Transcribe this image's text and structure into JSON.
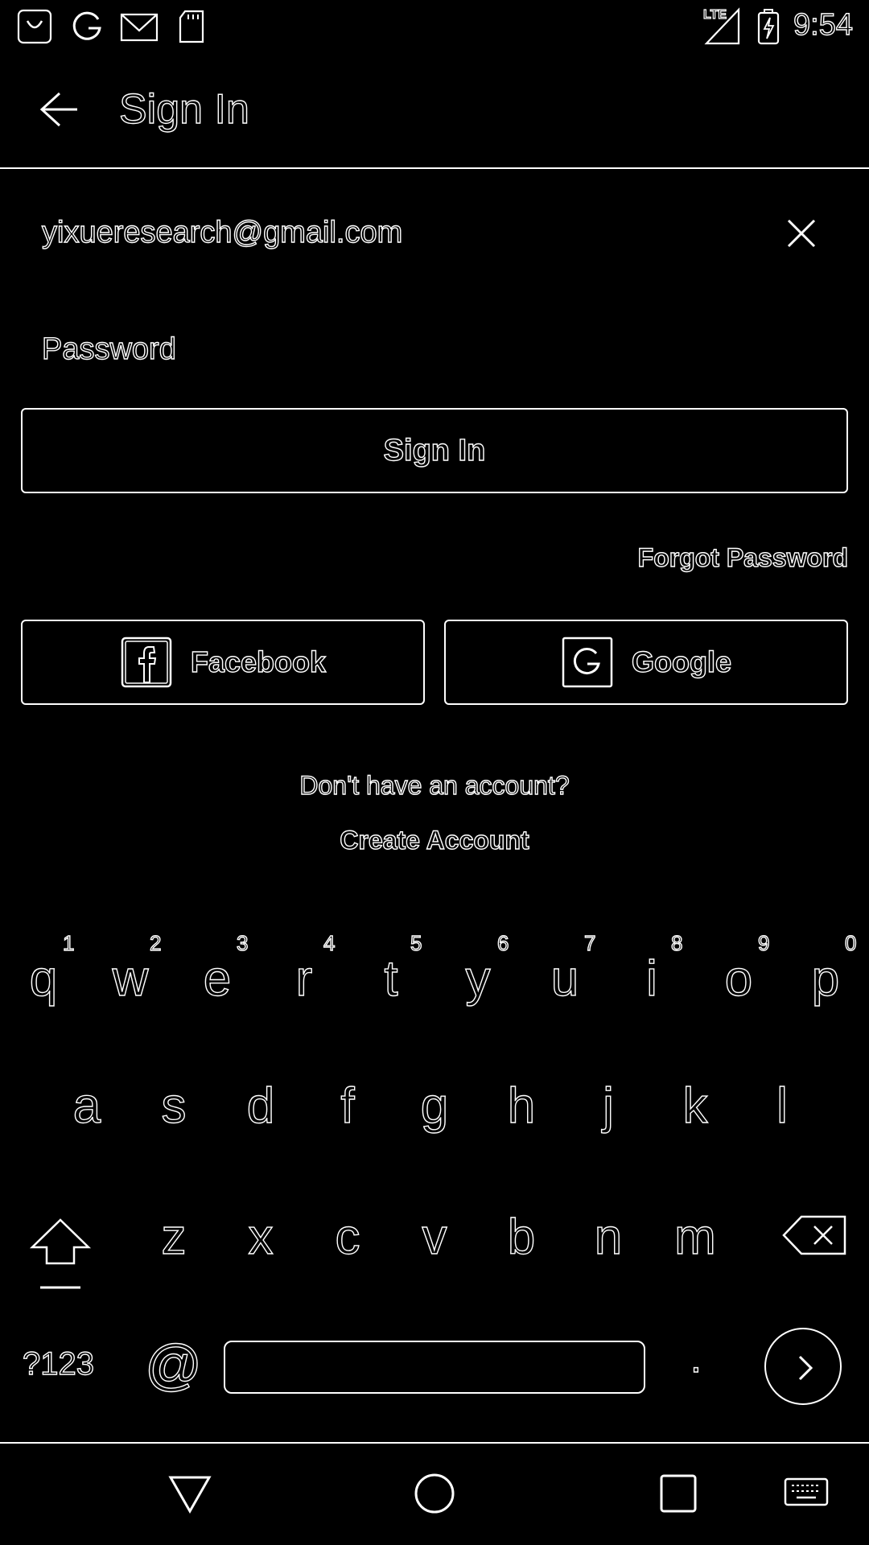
{
  "status_bar": {
    "left_icons": [
      "bag-icon",
      "google-icon",
      "mail-icon",
      "sd-card-icon"
    ],
    "right_icons": [
      "lte-signal-icon",
      "battery-charging-icon"
    ],
    "network_label": "LTE",
    "time": "9:54"
  },
  "app_bar": {
    "back_icon": "arrow-left-icon",
    "title": "Sign In"
  },
  "form": {
    "email_value": "yixueresearch@gmail.com",
    "clear_icon": "close-icon",
    "password_placeholder": "Password",
    "signin_label": "Sign In",
    "forgot_label": "Forgot Password",
    "facebook_label": "Facebook",
    "google_label": "Google",
    "no_account_text": "Don't have an account?",
    "create_account_label": "Create Account"
  },
  "keyboard": {
    "row1": [
      {
        "char": "q",
        "hint": "1"
      },
      {
        "char": "w",
        "hint": "2"
      },
      {
        "char": "e",
        "hint": "3"
      },
      {
        "char": "r",
        "hint": "4"
      },
      {
        "char": "t",
        "hint": "5"
      },
      {
        "char": "y",
        "hint": "6"
      },
      {
        "char": "u",
        "hint": "7"
      },
      {
        "char": "i",
        "hint": "8"
      },
      {
        "char": "o",
        "hint": "9"
      },
      {
        "char": "p",
        "hint": "0"
      }
    ],
    "row2": [
      "a",
      "s",
      "d",
      "f",
      "g",
      "h",
      "j",
      "k",
      "l"
    ],
    "row3": [
      "z",
      "x",
      "c",
      "v",
      "b",
      "n",
      "m"
    ],
    "symbols_label": "?123",
    "at_label": "@",
    "period_label": ".",
    "shift_icon": "shift-icon",
    "backspace_icon": "backspace-icon",
    "go_icon": "chevron-right-icon"
  },
  "nav_bar": {
    "icons": [
      "back-triangle-icon",
      "home-circle-icon",
      "recents-square-icon",
      "keyboard-icon"
    ]
  },
  "colors": {
    "background": "#000000",
    "foreground": "#ffffff"
  }
}
